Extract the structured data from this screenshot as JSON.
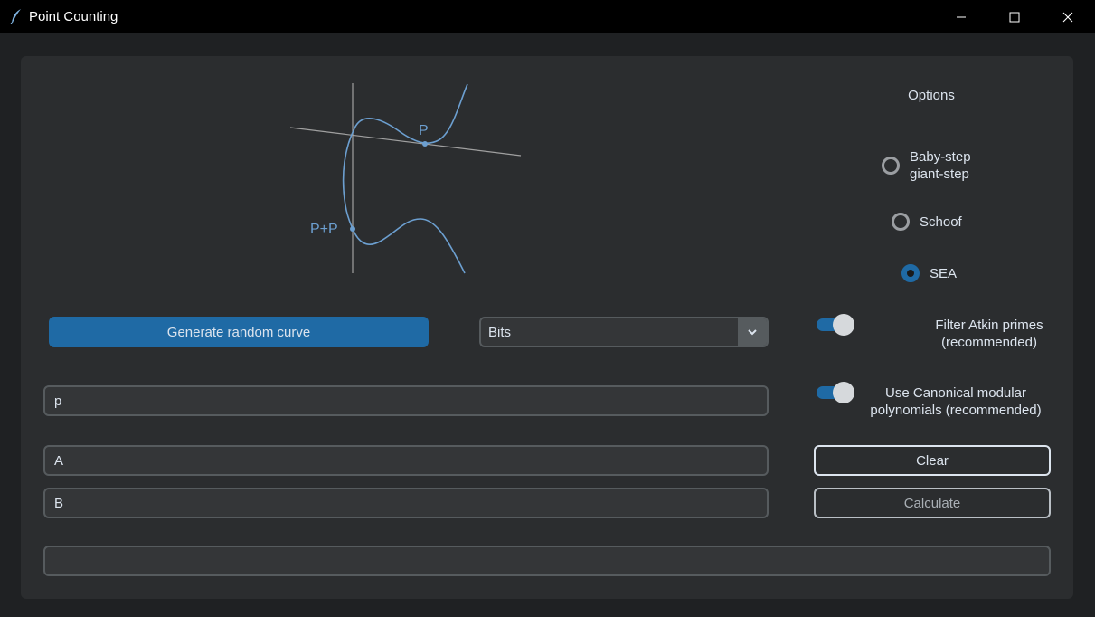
{
  "window": {
    "title": "Point Counting",
    "icon": "feather-icon",
    "controls": [
      "minimize-icon",
      "maximize-icon",
      "close-icon"
    ]
  },
  "illustration": {
    "point_label": "P",
    "double_label": "P+P",
    "curve_color": "#6c9fd0",
    "axis_color": "#a0a0a0"
  },
  "options": {
    "title": "Options",
    "algorithms": [
      {
        "label_line1": "Baby-step",
        "label_line2": "giant-step",
        "selected": false
      },
      {
        "label": "Schoof",
        "selected": false
      },
      {
        "label": "SEA",
        "selected": true
      }
    ],
    "filter_atkin": {
      "line1": "Filter Atkin primes",
      "line2": "(recommended)",
      "on": true
    },
    "canonical": {
      "line1": "Use Canonical modular",
      "line2": "polynomials (recommended)",
      "on": true
    }
  },
  "actions": {
    "generate_label": "Generate random curve",
    "bits_selected": "Bits",
    "clear_label": "Clear",
    "calculate_label": "Calculate"
  },
  "fields": {
    "p_placeholder": "p",
    "a_placeholder": "A",
    "b_placeholder": "B",
    "result_value": ""
  },
  "colors": {
    "accent": "#1f6aa5",
    "panel": "#2b2d2f",
    "background": "#1f2123",
    "entry_bg": "#343638",
    "border": "#565b5e",
    "text": "#dce4ee"
  }
}
